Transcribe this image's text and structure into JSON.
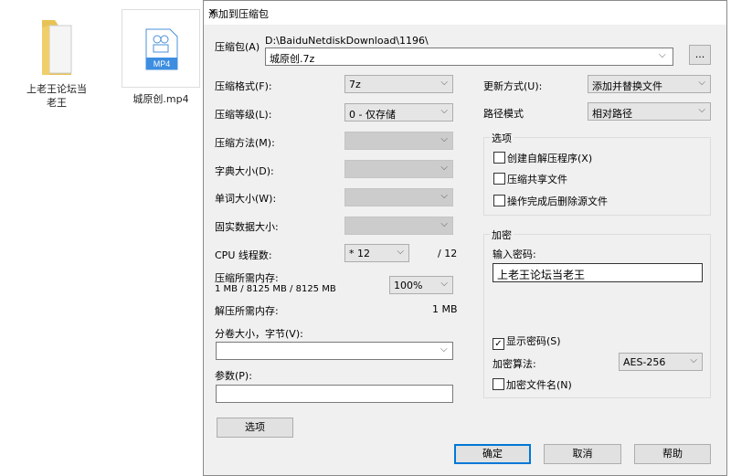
{
  "desktop": {
    "items": [
      {
        "label": "上老王论坛当老王",
        "icon": "folder-icon"
      },
      {
        "label": "城原创.mp4",
        "icon": "mp4-file-icon",
        "badge": "MP4"
      }
    ]
  },
  "dialog": {
    "title": "添加到压缩包",
    "close": "✕",
    "archive_label": "压缩包(A)",
    "archive_path": "D:\\BaiduNetdiskDownload\\1196\\",
    "archive_name": "城原创.7z",
    "browse": "...",
    "left": {
      "format_label": "压缩格式(F):",
      "format": "7z",
      "level_label": "压缩等级(L):",
      "level": "0 - 仅存储",
      "method_label": "压缩方法(M):",
      "dict_label": "字典大小(D):",
      "word_label": "单词大小(W):",
      "solid_label": "固实数据大小:",
      "cpu_label": "CPU 线程数:",
      "cpu": "* 12",
      "cpu_max": "/ 12",
      "mem_label": "压缩所需内存:",
      "mem_value": "1 MB / 8125 MB / 8125 MB",
      "mem_pct": "100%",
      "decomp_label": "解压所需内存:",
      "decomp_value": "1 MB",
      "split_label": "分卷大小，字节(V):",
      "split": "",
      "params_label": "参数(P):",
      "params": "",
      "options_button": "选项"
    },
    "right": {
      "update_label": "更新方式(U):",
      "update": "添加并替换文件",
      "path_label": "路径模式",
      "path": "相对路径",
      "options_group": "选项",
      "sfx": "创建自解压程序(X)",
      "shared": "压缩共享文件",
      "delete": "操作完成后删除源文件",
      "enc_group": "加密",
      "pwd_label": "输入密码:",
      "pwd": "上老王论坛当老王",
      "show_pwd": "显示密码(S)",
      "algo_label": "加密算法:",
      "algo": "AES-256",
      "enc_names": "加密文件名(N)"
    },
    "ok": "确定",
    "cancel": "取消",
    "help": "帮助"
  }
}
